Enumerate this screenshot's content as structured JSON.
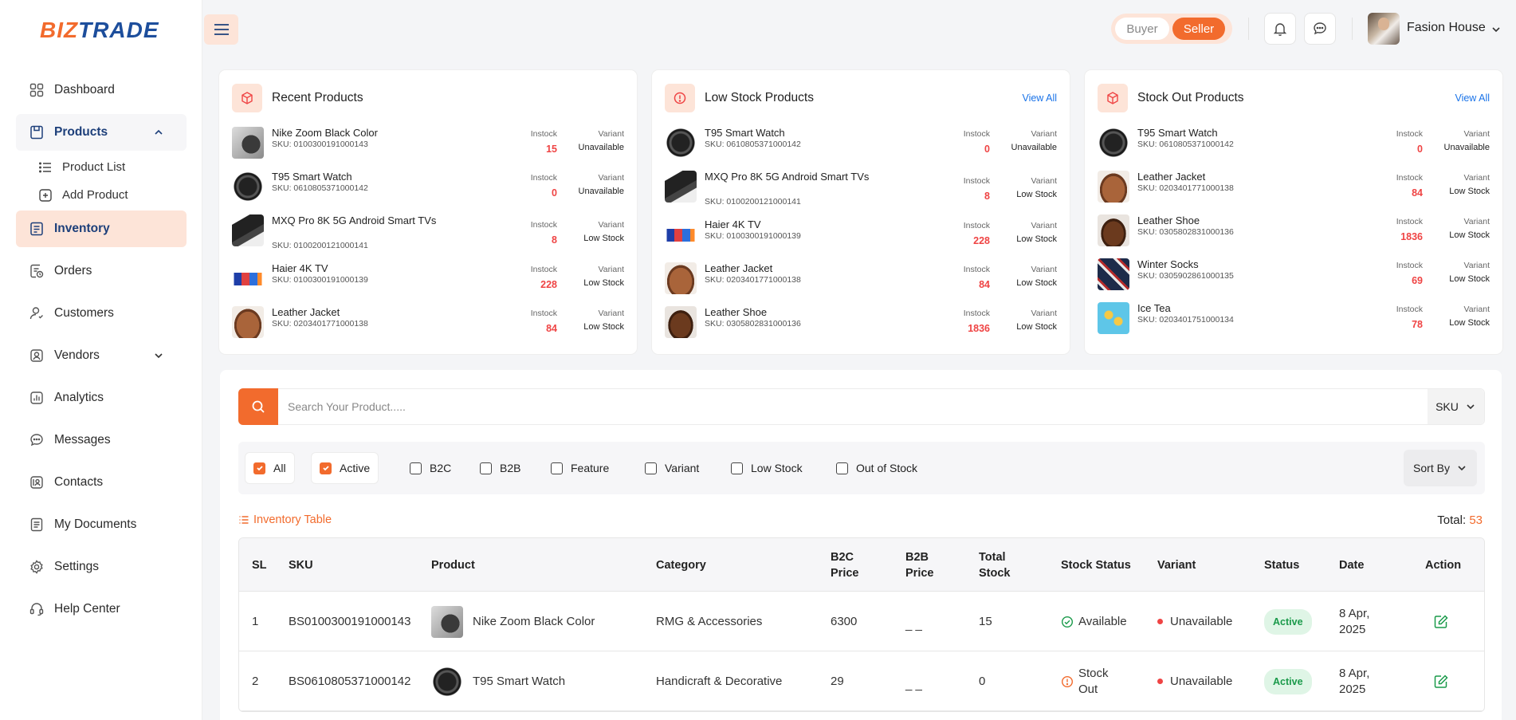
{
  "brand": {
    "part1": "BIZ",
    "part2": "TRADE"
  },
  "sidebar": {
    "items": [
      {
        "label": "Dashboard",
        "icon": "dashboard-icon"
      },
      {
        "label": "Products",
        "icon": "products-icon"
      },
      {
        "label": "Inventory",
        "icon": "inventory-icon"
      },
      {
        "label": "Orders",
        "icon": "orders-icon"
      },
      {
        "label": "Customers",
        "icon": "customers-icon"
      },
      {
        "label": "Vendors",
        "icon": "vendors-icon"
      },
      {
        "label": "Analytics",
        "icon": "analytics-icon"
      },
      {
        "label": "Messages",
        "icon": "messages-icon"
      },
      {
        "label": "Contacts",
        "icon": "contacts-icon"
      },
      {
        "label": "My Documents",
        "icon": "documents-icon"
      },
      {
        "label": "Settings",
        "icon": "settings-icon"
      },
      {
        "label": "Help Center",
        "icon": "help-icon"
      }
    ],
    "products_sub": [
      "Product List",
      "Add Product"
    ]
  },
  "header": {
    "buyer_label": "Buyer",
    "seller_label": "Seller",
    "user_name": "Fasion House"
  },
  "cards": [
    {
      "title": "Recent Products",
      "view_all": "",
      "rows": [
        {
          "name": "Nike Zoom Black Color",
          "sku": "SKU: 0100300191000143",
          "instock_label": "Instock",
          "instock": "15",
          "variant_label": "Variant",
          "variant": "Unavailable",
          "img": "shoe"
        },
        {
          "name": "T95 Smart Watch",
          "sku": "SKU: 0610805371000142",
          "instock_label": "Instock",
          "instock": "0",
          "variant_label": "Variant",
          "variant": "Unavailable",
          "img": "watch"
        },
        {
          "name": "MXQ Pro 8K 5G Android Smart TVs",
          "sku": "SKU: 0100200121000141",
          "instock_label": "Instock",
          "instock": "8",
          "variant_label": "Variant",
          "variant": "Low Stock",
          "img": "phone"
        },
        {
          "name": "Haier 4K TV",
          "sku": "SKU: 0100300191000139",
          "instock_label": "Instock",
          "instock": "228",
          "variant_label": "Variant",
          "variant": "Low Stock",
          "img": "tv"
        },
        {
          "name": "Leather Jacket",
          "sku": "SKU: 0203401771000138",
          "instock_label": "Instock",
          "instock": "84",
          "variant_label": "Variant",
          "variant": "Low Stock",
          "img": "jacket"
        }
      ]
    },
    {
      "title": "Low Stock Products",
      "view_all": "View All",
      "rows": [
        {
          "name": "T95 Smart Watch",
          "sku": "SKU: 0610805371000142",
          "instock_label": "Instock",
          "instock": "0",
          "variant_label": "Variant",
          "variant": "Unavailable",
          "img": "watch"
        },
        {
          "name": "MXQ Pro 8K 5G Android Smart TVs",
          "sku": "SKU: 0100200121000141",
          "instock_label": "Instock",
          "instock": "8",
          "variant_label": "Variant",
          "variant": "Low Stock",
          "img": "phone"
        },
        {
          "name": "Haier 4K TV",
          "sku": "SKU: 0100300191000139",
          "instock_label": "Instock",
          "instock": "228",
          "variant_label": "Variant",
          "variant": "Low Stock",
          "img": "tv"
        },
        {
          "name": "Leather Jacket",
          "sku": "SKU: 0203401771000138",
          "instock_label": "Instock",
          "instock": "84",
          "variant_label": "Variant",
          "variant": "Low Stock",
          "img": "jacket"
        },
        {
          "name": "Leather Shoe",
          "sku": "SKU: 0305802831000136",
          "instock_label": "Instock",
          "instock": "1836",
          "variant_label": "Variant",
          "variant": "Low Stock",
          "img": "lshoe"
        }
      ]
    },
    {
      "title": "Stock Out Products",
      "view_all": "View All",
      "rows": [
        {
          "name": "T95 Smart Watch",
          "sku": "SKU: 0610805371000142",
          "instock_label": "Instock",
          "instock": "0",
          "variant_label": "Variant",
          "variant": "Unavailable",
          "img": "watch"
        },
        {
          "name": "Leather Jacket",
          "sku": "SKU: 0203401771000138",
          "instock_label": "Instock",
          "instock": "84",
          "variant_label": "Variant",
          "variant": "Low Stock",
          "img": "jacket"
        },
        {
          "name": "Leather Shoe",
          "sku": "SKU: 0305802831000136",
          "instock_label": "Instock",
          "instock": "1836",
          "variant_label": "Variant",
          "variant": "Low Stock",
          "img": "lshoe"
        },
        {
          "name": "Winter Socks",
          "sku": "SKU: 0305902861000135",
          "instock_label": "Instock",
          "instock": "69",
          "variant_label": "Variant",
          "variant": "Low Stock",
          "img": "socks"
        },
        {
          "name": "Ice Tea",
          "sku": "SKU: 0203401751000134",
          "instock_label": "Instock",
          "instock": "78",
          "variant_label": "Variant",
          "variant": "Low Stock",
          "img": "tea"
        }
      ]
    }
  ],
  "search": {
    "placeholder": "Search Your Product.....",
    "mode": "SKU"
  },
  "filters": [
    {
      "label": "All",
      "checked": true
    },
    {
      "label": "Active",
      "checked": true
    },
    {
      "label": "B2C",
      "checked": false
    },
    {
      "label": "B2B",
      "checked": false
    },
    {
      "label": "Feature",
      "checked": false
    },
    {
      "label": "Variant",
      "checked": false
    },
    {
      "label": "Low Stock",
      "checked": false
    },
    {
      "label": "Out of Stock",
      "checked": false
    }
  ],
  "sort_label": "Sort By",
  "table": {
    "title": "Inventory Table",
    "total_label": "Total:",
    "total": "53",
    "headers": [
      "SL",
      "SKU",
      "Product",
      "Category",
      "B2C Price",
      "B2B Price",
      "Total Stock",
      "Stock Status",
      "Variant",
      "Status",
      "Date",
      "Action"
    ],
    "rows": [
      {
        "sl": "1",
        "sku": "BS0100300191000143",
        "product": "Nike Zoom Black Color",
        "img": "shoe",
        "category": "RMG & Accessories",
        "b2c": "6300",
        "b2b": "_ _",
        "stock": "15",
        "stock_status": "Available",
        "stock_ok": true,
        "variant": "Unavailable",
        "status": "Active",
        "date": "8 Apr, 2025"
      },
      {
        "sl": "2",
        "sku": "BS0610805371000142",
        "product": "T95 Smart Watch",
        "img": "watch",
        "category": "Handicraft & Decorative",
        "b2c": "29",
        "b2b": "_ _",
        "stock": "0",
        "stock_status": "Stock Out",
        "stock_ok": false,
        "variant": "Unavailable",
        "status": "Active",
        "date": "8 Apr, 2025"
      }
    ]
  },
  "colors": {
    "accent": "#f26b2d",
    "brand_blue": "#1d4e9c",
    "danger": "#ef4444",
    "success": "#1a9a4a",
    "link": "#1a73e8"
  }
}
